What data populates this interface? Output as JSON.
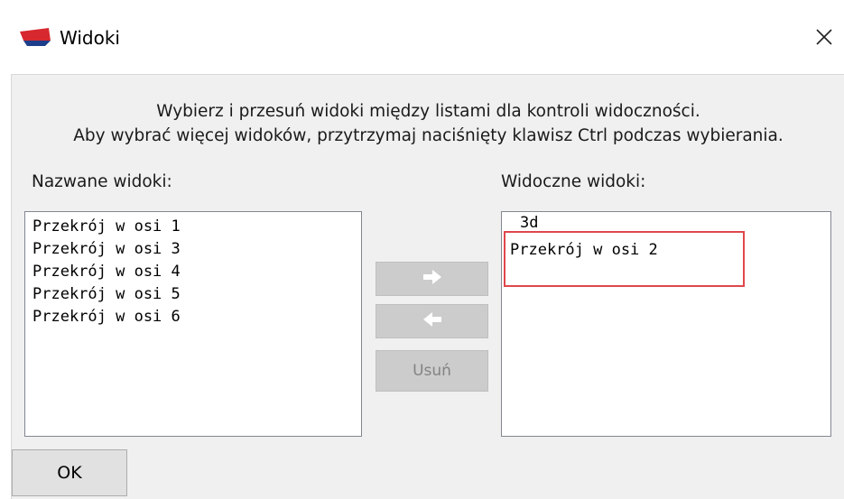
{
  "window": {
    "title": "Widoki",
    "icon": "app-logo-icon",
    "close_icon": "close-icon"
  },
  "instructions": {
    "line1": "Wybierz i przesuń widoki między listami dla kontroli widoczności.",
    "line2": "Aby wybrać więcej widoków, przytrzymaj naciśnięty klawisz Ctrl podczas wybierania."
  },
  "named_views": {
    "label": "Nazwane widoki:",
    "items": [
      "Przekrój w osi 1",
      "Przekrój w osi 3",
      "Przekrój w osi 4",
      "Przekrój w osi 5",
      "Przekrój w osi 6"
    ]
  },
  "visible_views": {
    "label": "Widoczne widoki:",
    "items": [
      "3d",
      "Przekrój w osi 2"
    ]
  },
  "buttons": {
    "move_right_icon": "arrow-right-icon",
    "move_left_icon": "arrow-left-icon",
    "delete_label": "Usuń",
    "ok_label": "OK"
  },
  "colors": {
    "highlight_border": "#e0474c",
    "dialog_bg": "#f0f0f0",
    "disabled_button_bg": "#cccccc"
  }
}
